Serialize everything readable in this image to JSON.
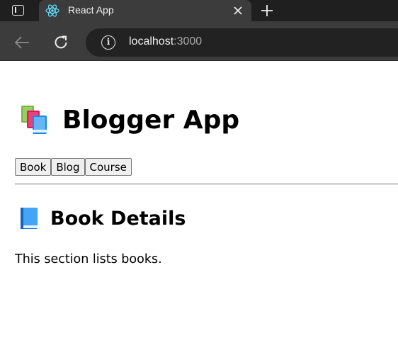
{
  "browser": {
    "tab_title": "React App",
    "url_host": "localhost",
    "url_port": ":3000",
    "icons": [
      "sidebar-toggle-icon",
      "react-logo-icon",
      "close-icon",
      "plus-icon",
      "back-arrow-icon",
      "reload-icon",
      "info-icon"
    ]
  },
  "app": {
    "title": "Blogger App",
    "title_icon": "books-emoji",
    "nav": [
      "Book",
      "Blog",
      "Course"
    ],
    "section_title": "Book Details",
    "section_icon": "blue-book-emoji",
    "section_text": "This section lists books."
  },
  "colors": {
    "chrome_dark": "#1f1f1f",
    "chrome_toolbar": "#3c3c3c",
    "omnibox": "#222222",
    "button_bg": "#efefef"
  }
}
